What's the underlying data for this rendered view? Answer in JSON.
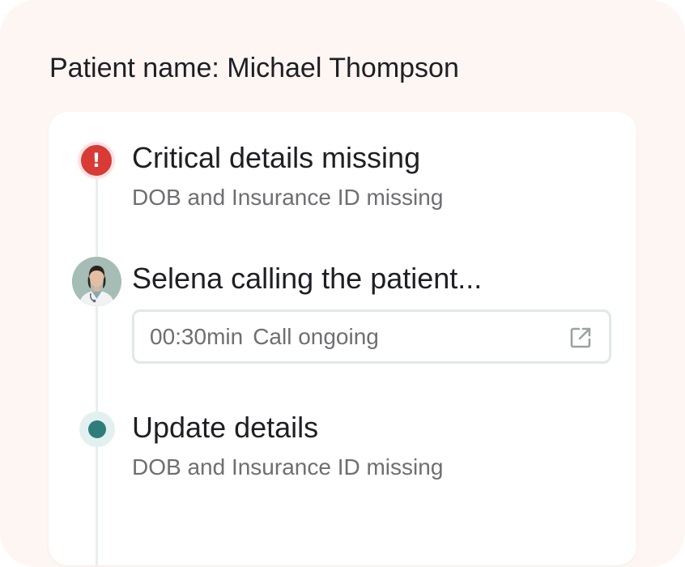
{
  "patient": {
    "title": "Patient name: Michael Thompson"
  },
  "timeline": {
    "steps": [
      {
        "title": "Critical details missing",
        "subtitle": "DOB and Insurance ID missing",
        "icon": "alert-icon",
        "icon_glyph": "!",
        "icon_color": "#d93a36"
      },
      {
        "title": "Selena calling the patient...",
        "icon": "avatar",
        "call": {
          "duration": "00:30min",
          "status": "Call ongoing",
          "action_icon": "open-external-icon"
        }
      },
      {
        "title": "Update details",
        "subtitle": "DOB and Insurance ID missing",
        "icon": "status-dot-icon",
        "icon_color": "#2f7d7a"
      }
    ]
  },
  "colors": {
    "background": "#fdf6f3",
    "card": "#ffffff",
    "alert": "#d93a36",
    "accent": "#2f7d7a",
    "timeline_line": "#e6efee"
  }
}
